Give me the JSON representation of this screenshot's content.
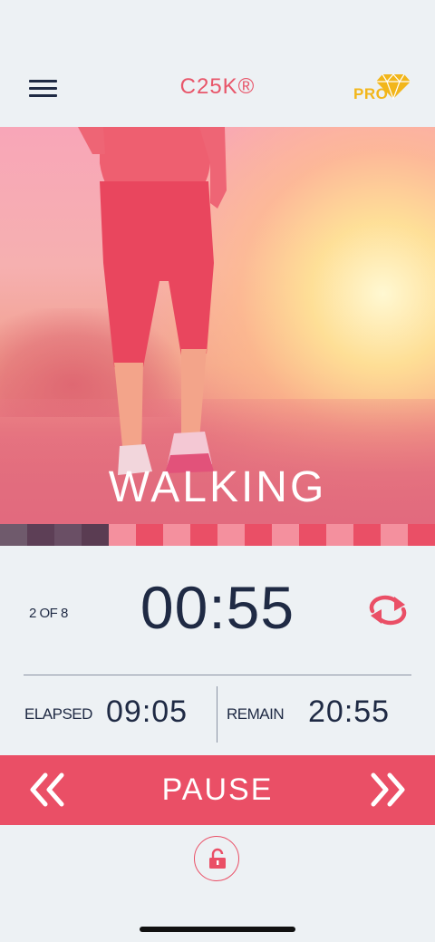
{
  "header": {
    "title": "C25K®",
    "pro_label": "PRO",
    "menu_icon": "hamburger-menu-icon",
    "pro_icon": "diamond-icon"
  },
  "hero": {
    "stage_label": "WALKING"
  },
  "progress": {
    "segments": [
      {
        "color": "#6f5a6c"
      },
      {
        "color": "#5d3f56"
      },
      {
        "color": "#6a4f65"
      },
      {
        "color": "#5a3c52"
      },
      {
        "color": "#f4909e"
      },
      {
        "color": "#ea4f66"
      },
      {
        "color": "#f4909e"
      },
      {
        "color": "#ea4f66"
      },
      {
        "color": "#f4909e"
      },
      {
        "color": "#ea4f66"
      },
      {
        "color": "#f4909e"
      },
      {
        "color": "#ea4f66"
      },
      {
        "color": "#f4909e"
      },
      {
        "color": "#ea4f66"
      },
      {
        "color": "#f4909e"
      },
      {
        "color": "#ea4f66"
      }
    ]
  },
  "timer": {
    "interval_count": "2 OF 8",
    "current": "00:55",
    "repeat_icon": "repeat-icon"
  },
  "stats": {
    "elapsed_label": "ELAPSED",
    "elapsed_value": "09:05",
    "remain_label": "REMAIN",
    "remain_value": "20:55"
  },
  "controls": {
    "pause_label": "PAUSE",
    "prev_icon": "double-chevron-left-icon",
    "next_icon": "double-chevron-right-icon",
    "lock_icon": "unlock-icon"
  },
  "colors": {
    "accent": "#ea4f66",
    "text": "#1f2a44",
    "pro": "#f2b61b",
    "background": "#edf1f4"
  }
}
